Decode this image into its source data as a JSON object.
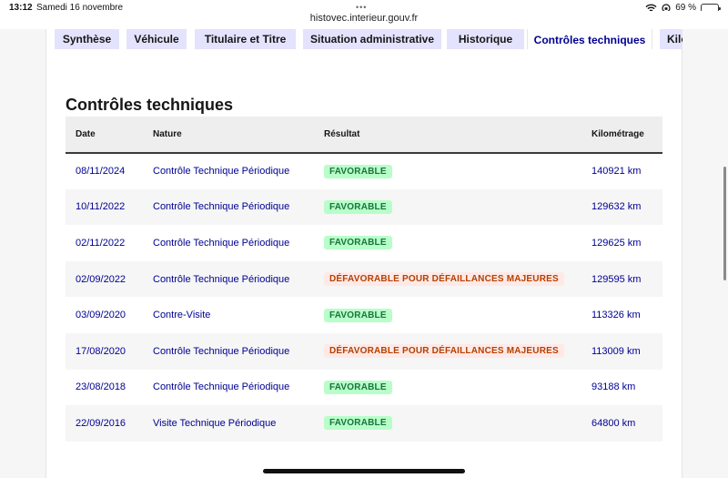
{
  "status_bar": {
    "time": "13:12",
    "date": "Samedi 16 novembre",
    "battery_percent": "69 %",
    "battery_level": 0.69
  },
  "browser": {
    "url": "histovec.interieur.gouv.fr"
  },
  "tabs": [
    {
      "label": "Synthèse",
      "active": false
    },
    {
      "label": "Véhicule",
      "active": false
    },
    {
      "label": "Titulaire et Titre",
      "active": false
    },
    {
      "label": "Situation administrative",
      "active": false
    },
    {
      "label": "Historique",
      "active": false
    },
    {
      "label": "Contrôles techniques",
      "active": true
    },
    {
      "label": "Kilo",
      "active": false
    }
  ],
  "section": {
    "title": "Contrôles techniques"
  },
  "table": {
    "headers": [
      "Date",
      "Nature",
      "Résultat",
      "Kilométrage"
    ],
    "rows": [
      {
        "date": "08/11/2024",
        "nature": "Contrôle Technique Périodique",
        "result": "FAVORABLE",
        "status": "fav",
        "km": "140921 km"
      },
      {
        "date": "10/11/2022",
        "nature": "Contrôle Technique Périodique",
        "result": "FAVORABLE",
        "status": "fav",
        "km": "129632 km"
      },
      {
        "date": "02/11/2022",
        "nature": "Contrôle Technique Périodique",
        "result": "FAVORABLE",
        "status": "fav",
        "km": "129625 km"
      },
      {
        "date": "02/09/2022",
        "nature": "Contrôle Technique Périodique",
        "result": "DÉFAVORABLE POUR DÉFAILLANCES MAJEURES",
        "status": "defav",
        "km": "129595 km"
      },
      {
        "date": "03/09/2020",
        "nature": "Contre-Visite",
        "result": "FAVORABLE",
        "status": "fav",
        "km": "113326 km"
      },
      {
        "date": "17/08/2020",
        "nature": "Contrôle Technique Périodique",
        "result": "DÉFAVORABLE POUR DÉFAILLANCES MAJEURES",
        "status": "defav",
        "km": "113009 km"
      },
      {
        "date": "23/08/2018",
        "nature": "Contrôle Technique Périodique",
        "result": "FAVORABLE",
        "status": "fav",
        "km": "93188 km"
      },
      {
        "date": "22/09/2016",
        "nature": "Visite Technique Périodique",
        "result": "FAVORABLE",
        "status": "fav",
        "km": "64800 km"
      }
    ]
  },
  "colors": {
    "accent": "#000091",
    "favorable_bg": "#b8fec9",
    "favorable_text": "#18753c",
    "defavorable_bg": "#ffe9e6",
    "defavorable_text": "#b34000"
  }
}
